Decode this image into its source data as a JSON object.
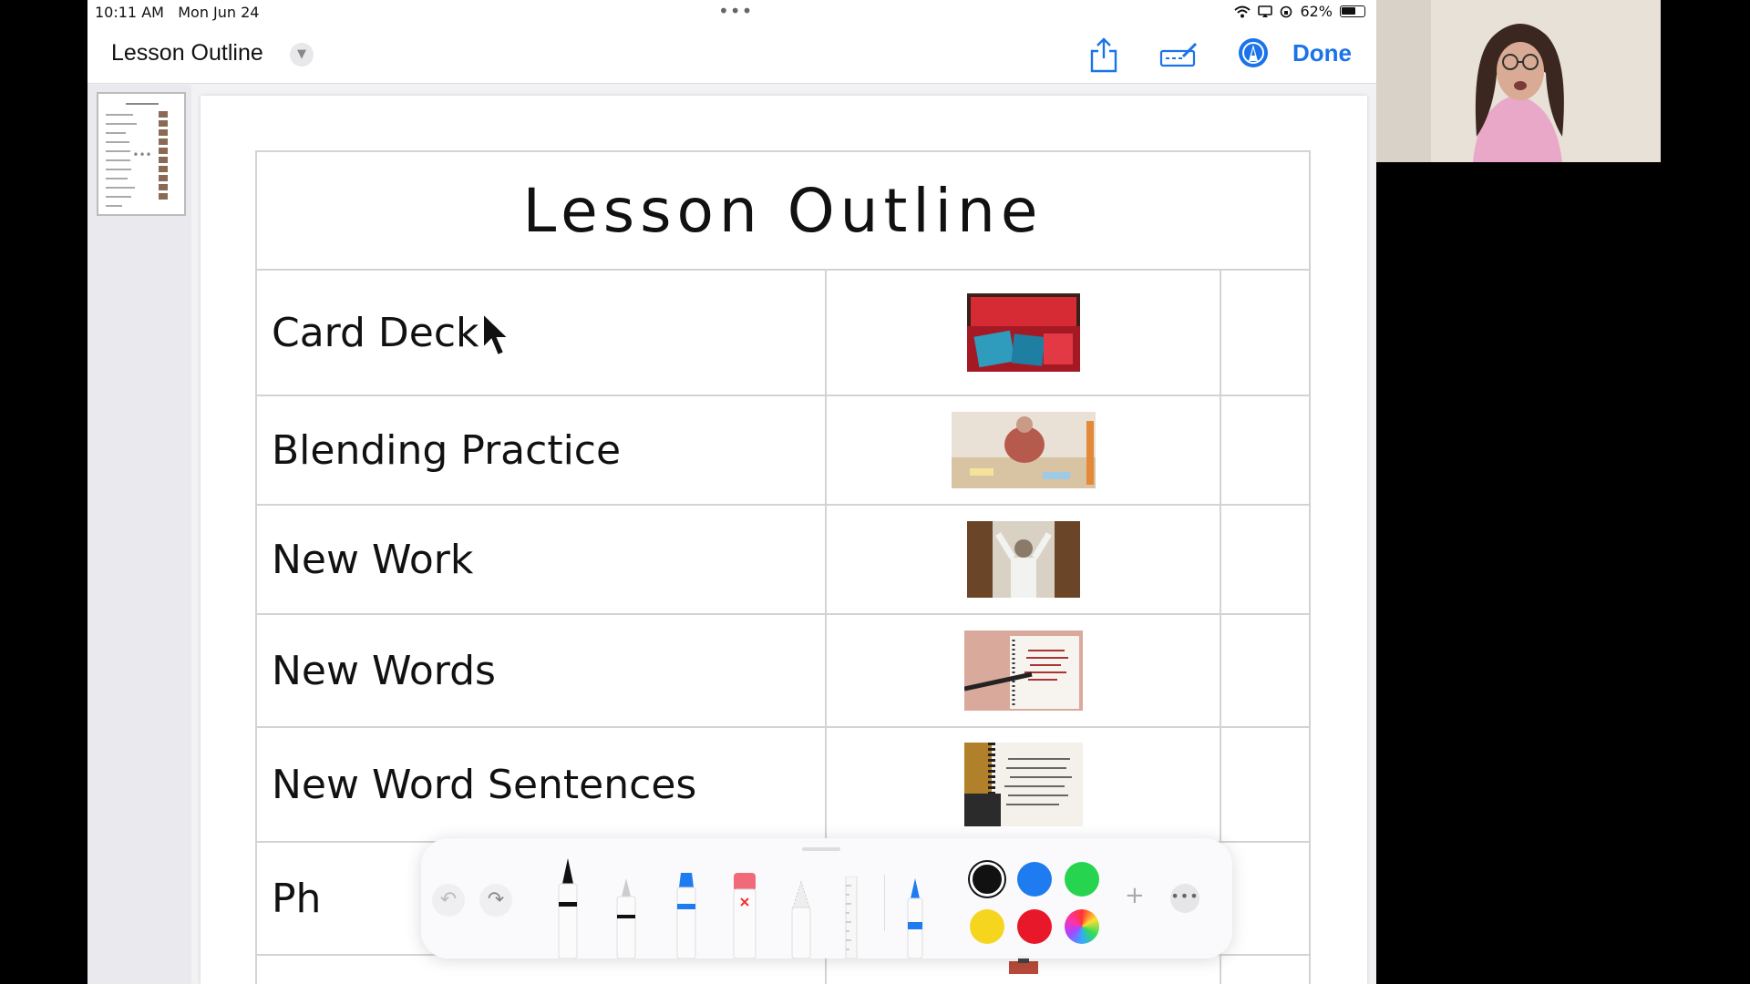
{
  "status_bar": {
    "time": "10:11 AM",
    "date": "Mon Jun 24",
    "battery": "62%"
  },
  "nav": {
    "title": "Lesson Outline",
    "done_label": "Done"
  },
  "document": {
    "title": "Lesson Outline",
    "rows": [
      {
        "label": "Card Deck",
        "image": "card-deck-photo"
      },
      {
        "label": "Blending Practice",
        "image": "blending-practice-photo"
      },
      {
        "label": "New Work",
        "image": "new-work-photo"
      },
      {
        "label": "New Words",
        "image": "new-words-photo"
      },
      {
        "label": "New Word Sentences",
        "image": "new-word-sentences-photo"
      },
      {
        "label": "Ph",
        "image": ""
      }
    ]
  },
  "toolbar": {
    "colors": [
      "#111111",
      "#1f7bf0",
      "#27d44f",
      "#f6d51f",
      "#e8182a"
    ],
    "tools": [
      "pen",
      "marker",
      "highlighter",
      "eraser",
      "lasso",
      "ruler",
      "fountain-pen"
    ]
  },
  "colors": {
    "accent": "#1a73e8"
  }
}
